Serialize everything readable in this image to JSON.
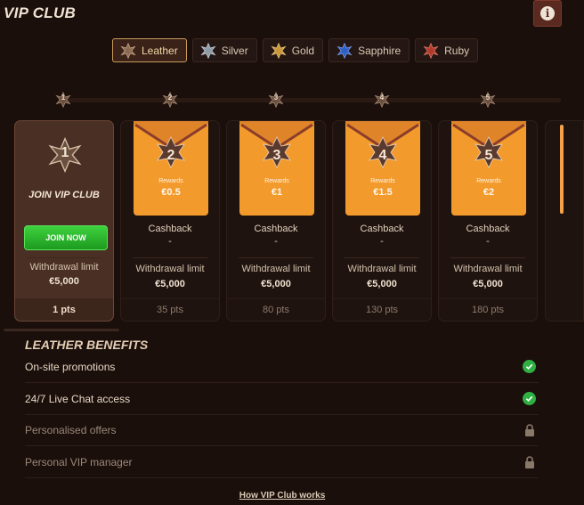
{
  "header": {
    "title": "VIP CLUB",
    "info_icon": "info-icon"
  },
  "tabs": [
    {
      "label": "Leather",
      "color": "#8a6a52",
      "active": true
    },
    {
      "label": "Silver",
      "color": "#8e9aa6",
      "active": false
    },
    {
      "label": "Gold",
      "color": "#c9963a",
      "active": false
    },
    {
      "label": "Sapphire",
      "color": "#2e5fc8",
      "active": false
    },
    {
      "label": "Ruby",
      "color": "#b23a2a",
      "active": false
    }
  ],
  "levels": {
    "markers": [
      "1",
      "2",
      "3",
      "4",
      "5"
    ],
    "first": {
      "level": "1",
      "join_label": "JOIN VIP CLUB",
      "join_button": "JOIN NOW",
      "withdrawal_label": "Withdrawal limit",
      "withdrawal_value": "€5,000",
      "points": "1 pts"
    },
    "cards": [
      {
        "level": "2",
        "rewards_label": "Rewards",
        "rewards": "€0.5",
        "cashback_label": "Cashback",
        "cashback": "-",
        "withdrawal_label": "Withdrawal limit",
        "withdrawal_value": "€5,000",
        "points": "35 pts"
      },
      {
        "level": "3",
        "rewards_label": "Rewards",
        "rewards": "€1",
        "cashback_label": "Cashback",
        "cashback": "-",
        "withdrawal_label": "Withdrawal limit",
        "withdrawal_value": "€5,000",
        "points": "80 pts"
      },
      {
        "level": "4",
        "rewards_label": "Rewards",
        "rewards": "€1.5",
        "cashback_label": "Cashback",
        "cashback": "-",
        "withdrawal_label": "Withdrawal limit",
        "withdrawal_value": "€5,000",
        "points": "130 pts"
      },
      {
        "level": "5",
        "rewards_label": "Rewards",
        "rewards": "€2",
        "cashback_label": "Cashback",
        "cashback": "-",
        "withdrawal_label": "Withdrawal limit",
        "withdrawal_value": "€5,000",
        "points": "180 pts"
      }
    ]
  },
  "benefits": {
    "title": "LEATHER BENEFITS",
    "items": [
      {
        "label": "On-site promotions",
        "status": "check-icon"
      },
      {
        "label": "24/7 Live Chat access",
        "status": "check-icon"
      },
      {
        "label": "Personalised offers",
        "status": "lock-icon"
      },
      {
        "label": "Personal VIP manager",
        "status": "lock-icon"
      }
    ]
  },
  "footer": {
    "link": "How VIP Club works"
  }
}
